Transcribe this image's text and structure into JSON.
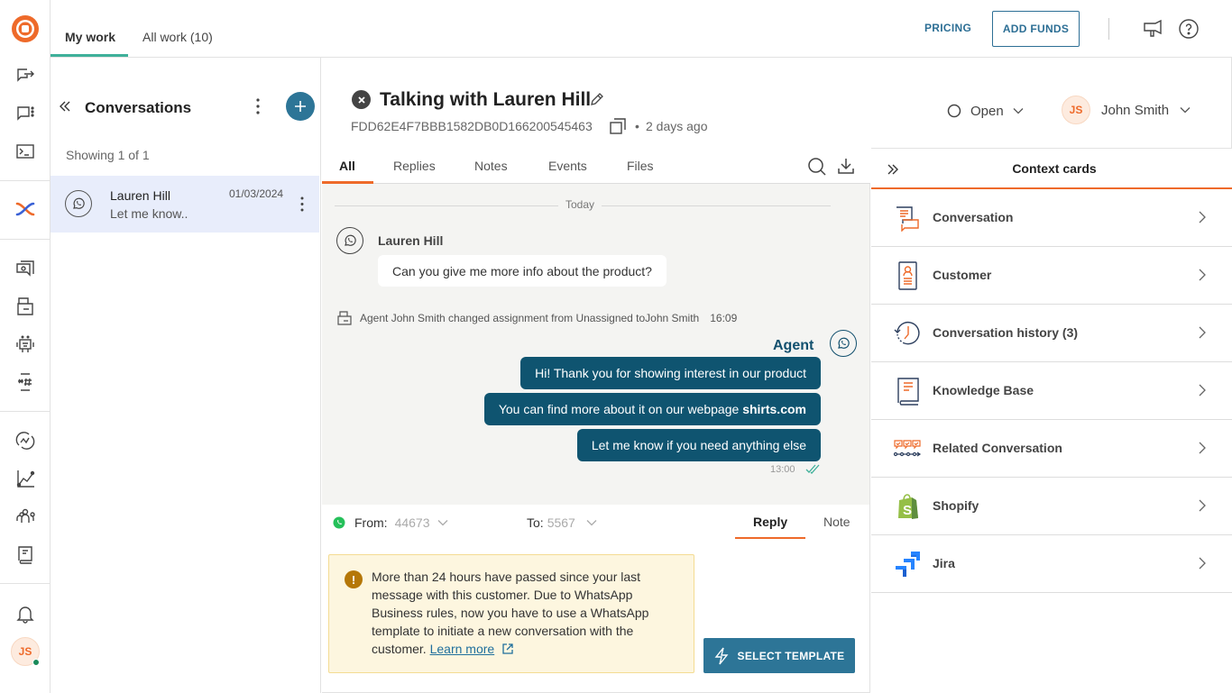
{
  "top_tabs": [
    {
      "label": "My work",
      "active": true
    },
    {
      "label": "All work (10)",
      "active": false
    }
  ],
  "topbar": {
    "pricing_label": "PRICING",
    "add_funds_label": "ADD FUNDS"
  },
  "rail": {
    "icons": [
      "logo-icon",
      "outbound-icon",
      "conversations-icon",
      "terminal-icon",
      "integrations-icon",
      "inbox-icon",
      "tickets-icon",
      "bots-icon",
      "hashtag-icon",
      "automation-icon",
      "analytics-icon",
      "contacts-icon",
      "docs-icon",
      "notifications-icon"
    ],
    "user_initials": "JS",
    "user_status_color": "#1a8a5a"
  },
  "conversations": {
    "title": "Conversations",
    "showing": "Showing 1 of 1",
    "items": [
      {
        "name": "Lauren Hill",
        "preview": "Let me know..",
        "date": "01/03/2024",
        "channel": "whatsapp"
      }
    ]
  },
  "conversation": {
    "title": "Talking with Lauren Hill",
    "id": "FDD62E4F7BBB1582DB0D166200545463",
    "age": "2 days ago",
    "status": "Open",
    "assignee": "John Smith",
    "assignee_initials": "JS"
  },
  "chat_tabs": [
    {
      "label": "All",
      "active": true
    },
    {
      "label": "Replies",
      "active": false
    },
    {
      "label": "Notes",
      "active": false
    },
    {
      "label": "Events",
      "active": false
    },
    {
      "label": "Files",
      "active": false
    }
  ],
  "chat": {
    "date_divider": "Today",
    "incoming": {
      "sender": "Lauren Hill",
      "text": "Can you give me more info about the product?"
    },
    "event": {
      "text": "Agent John Smith changed assignment from Unassigned toJohn Smith",
      "time": "16:09"
    },
    "agent_label": "Agent",
    "outgoing": [
      {
        "text": "Hi! Thank you for showing interest in our product",
        "bold": ""
      },
      {
        "text": "You can find more about it on our webpage ",
        "bold": "shirts.com"
      },
      {
        "text": "Let me know if you need anything else",
        "bold": ""
      }
    ],
    "outgoing_time": "13:00"
  },
  "composer": {
    "from_label": "From:",
    "from_value": "44673",
    "to_label": "To:",
    "to_value": "5567",
    "reply_tab": "Reply",
    "note_tab": "Note",
    "warning_text": "More than 24 hours have passed since your last message with this customer. Due to WhatsApp Business rules, now you have to use a WhatsApp template to initiate a new conversation with the customer. ",
    "learn_more": "Learn more",
    "select_template": "SELECT TEMPLATE"
  },
  "context_cards": {
    "title": "Context cards",
    "items": [
      {
        "label": "Conversation",
        "icon": "conversation-icon"
      },
      {
        "label": "Customer",
        "icon": "customer-icon"
      },
      {
        "label": "Conversation history (3)",
        "icon": "history-icon"
      },
      {
        "label": "Knowledge Base",
        "icon": "knowledge-base-icon"
      },
      {
        "label": "Related Conversation",
        "icon": "related-conversation-icon"
      },
      {
        "label": "Shopify",
        "icon": "shopify-icon"
      },
      {
        "label": "Jira",
        "icon": "jira-icon"
      }
    ]
  },
  "colors": {
    "accent": "#ee6a2a",
    "primary": "#2d7597",
    "agent_bubble": "#0f5470",
    "active_tab_teal": "#3fb09a"
  }
}
